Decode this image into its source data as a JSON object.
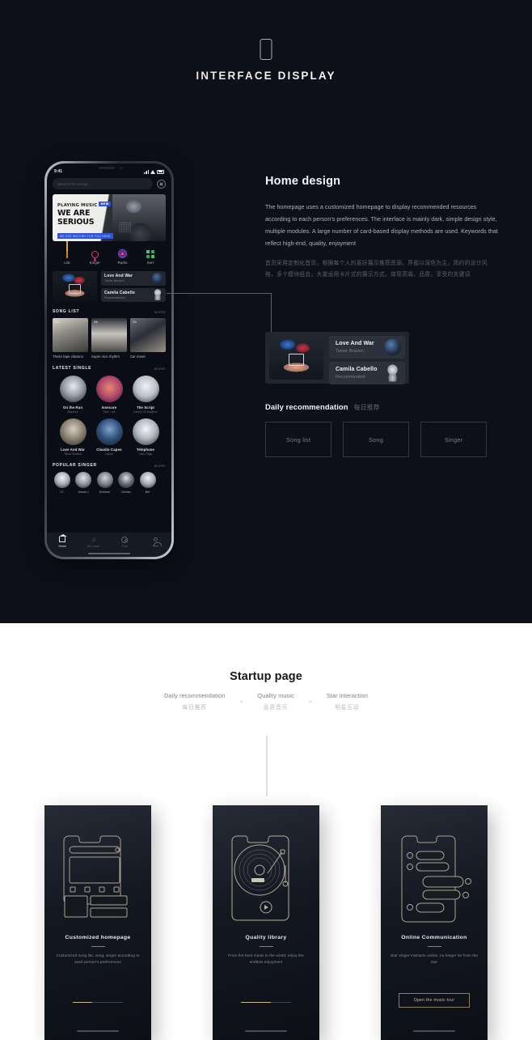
{
  "hero": {
    "title": "INTERFACE DISPLAY",
    "phone_icon": "phone-outline-icon"
  },
  "phone": {
    "status": {
      "time": "9:41",
      "signal_icon": "signal-bars-icon",
      "wifi_icon": "wifi-icon",
      "battery_icon": "battery-icon"
    },
    "search": {
      "placeholder": "Search for songs",
      "close_icon": "close-circle-icon"
    },
    "banner": {
      "line1": "PLAYING MUSIC",
      "tag": "NEW",
      "line2": "WE ARE SERIOUS",
      "sub": "WE ARE WAITING FOR YOU HERE"
    },
    "categories": [
      {
        "label": "List",
        "icon": "bar-chart-icon"
      },
      {
        "label": "Singer",
        "icon": "microphone-icon"
      },
      {
        "label": "Radio",
        "icon": "radio-waves-icon"
      },
      {
        "label": "Sort",
        "icon": "grid-squares-icon"
      }
    ],
    "feature": [
      {
        "title": "Love And War",
        "sub": "Tamar Braxton",
        "avatar": "album-avatar"
      },
      {
        "title": "Camila Cabello",
        "sub": "Recommended",
        "avatar": "portrait-avatar"
      }
    ],
    "song_list": {
      "heading": "SONG LIST",
      "more": "MORE",
      "items": [
        {
          "caption": "Those tape classics",
          "badge": "60k"
        },
        {
          "caption": "Super nice rhythm",
          "badge": "80k"
        },
        {
          "caption": "Car music",
          "badge": "21k"
        }
      ]
    },
    "latest_single": {
      "heading": "LATEST SINGLE",
      "more": "MORE",
      "items": [
        {
          "title": "On the Run",
          "sub": "Beyonce"
        },
        {
          "title": "Insecure",
          "sub": "Stwo ; ets"
        },
        {
          "title": "The Script",
          "sub": "Danny O'Donoghue"
        },
        {
          "title": "Love And War",
          "sub": "Tamar Braxton"
        },
        {
          "title": "Claudio Capeo",
          "sub": "Capeo"
        },
        {
          "title": "Telephone",
          "sub": "Lady Gaga"
        }
      ]
    },
    "popular_singer": {
      "heading": "POPULAR SINGER",
      "more": "MORE",
      "items": [
        {
          "label": "J.T"
        },
        {
          "label": "Jessie J"
        },
        {
          "label": "Eminem"
        },
        {
          "label": "Declan"
        },
        {
          "label": "Bet"
        }
      ]
    },
    "tabbar": [
      {
        "label": "Home",
        "icon": "home-icon",
        "active": true
      },
      {
        "label": "My music",
        "icon": "music-note-icon",
        "active": false
      },
      {
        "label": "Find",
        "icon": "compass-icon",
        "active": false
      },
      {
        "label": "Mine",
        "icon": "person-icon",
        "active": false
      }
    ]
  },
  "home_design": {
    "title": "Home design",
    "body_en": "The homepage uses a customized homepage to display recommended resources according to each person's preferences. The interface is mainly dark, simple design style, multiple modules. A large number of card-based display methods are used. Keywords that reflect high-end, quality, enjoyment",
    "body_cn": "首页采用定制化首页，根据每个人的喜好展示推荐资源。界面以深色为主，简约的设计风格，多个模块组合，大量运用卡片式的展示方式。体现高端，品质，享受的关键词"
  },
  "detail_card": {
    "artwork": "album-artwork",
    "rows": [
      {
        "title": "Love And War",
        "sub": "Tamar Braxton",
        "avatar": "album-avatar"
      },
      {
        "title": "Camila Cabello",
        "sub": "Recommended",
        "avatar": "portrait-avatar"
      }
    ]
  },
  "daily": {
    "title_en": "Daily recommendation",
    "title_cn": "每日推荐",
    "boxes": [
      {
        "label": "Song list"
      },
      {
        "label": "Song"
      },
      {
        "label": "Singer"
      }
    ]
  },
  "startup": {
    "title": "Startup page",
    "separator": "×",
    "keywords": [
      {
        "en": "Daily recommendation",
        "cn": "每日推荐"
      },
      {
        "en": "Quality music",
        "cn": "品质音乐"
      },
      {
        "en": "Star interaction",
        "cn": "明星互动"
      }
    ]
  },
  "cards": [
    {
      "illustration": "phone-wireframe-icon",
      "title": "Customized homepage",
      "desc": "Customized song list, song, singer according to each person's preferences",
      "progress": 38,
      "button": null
    },
    {
      "illustration": "turntable-vinyl-icon",
      "title": "Quality library",
      "desc": "From the best music in the world, enjoy the endless enjoyment",
      "progress": 60,
      "button": null
    },
    {
      "illustration": "chat-bubbles-icon",
      "title": "Online Communication",
      "desc": "Star singer interacts online, no longer far from the star",
      "progress": null,
      "button": "Open the music tour"
    }
  ],
  "colors": {
    "hero_bg": "#0d1019",
    "card_bg": "#22262f",
    "accent_gold": "#cbb98f",
    "text_muted": "#767d8b"
  }
}
